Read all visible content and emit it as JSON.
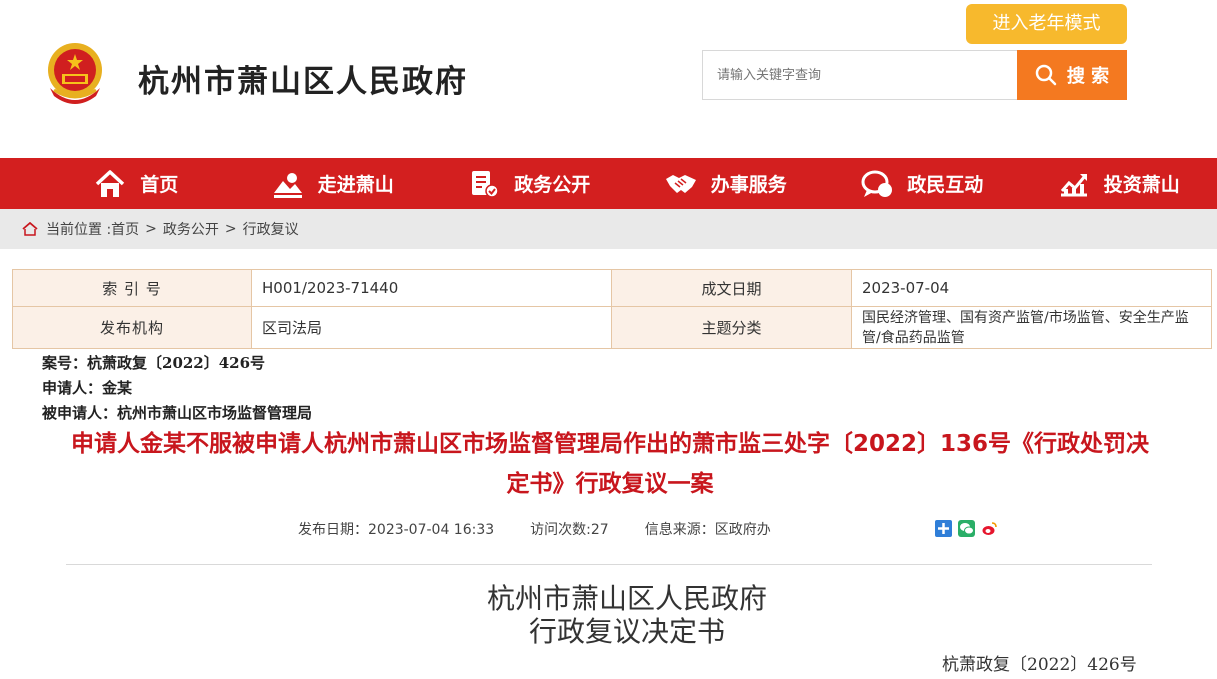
{
  "header": {
    "site_title": "杭州市萧山区人民政府",
    "elder_mode_label": "进入老年模式",
    "search_placeholder": "请输入关键字查询",
    "search_label": "搜 索"
  },
  "nav": {
    "items": [
      {
        "label": "首页",
        "icon": "home-icon"
      },
      {
        "label": "走进萧山",
        "icon": "landscape-icon"
      },
      {
        "label": "政务公开",
        "icon": "document-check-icon"
      },
      {
        "label": "办事服务",
        "icon": "handshake-icon"
      },
      {
        "label": "政民互动",
        "icon": "chat-icon"
      },
      {
        "label": "投资萧山",
        "icon": "chart-icon"
      }
    ]
  },
  "breadcrumb": {
    "prefix": "当前位置 :",
    "items": [
      "首页",
      "政务公开",
      "行政复议"
    ],
    "separator": ">"
  },
  "meta": {
    "index_label": "索 引 号",
    "index_value": "H001/2023-71440",
    "date_label": "成文日期",
    "date_value": "2023-07-04",
    "org_label": "发布机构",
    "org_value": "区司法局",
    "topic_label": "主题分类",
    "topic_value": "国民经济管理、国有资产监管/市场监管、安全生产监管/食品药品监管"
  },
  "case": {
    "case_no": "案号：杭萧政复〔2022〕426号",
    "applicant": "申请人：金某",
    "respondent": "被申请人：杭州市萧山区市场监督管理局"
  },
  "article": {
    "title": "申请人金某不服被申请人杭州市萧山区市场监督管理局作出的萧市监三处字〔2022〕136号《行政处罚决定书》行政复议一案",
    "publish_date": "发布日期：2023-07-04 16:33",
    "visits": "访问次数:27",
    "source": "信息来源：区政府办"
  },
  "document": {
    "issuer": "杭州市萧山区人民政府",
    "doc_title": "行政复议决定书",
    "doc_number": "杭萧政复〔2022〕426号"
  },
  "colors": {
    "nav_red": "#d31f1f",
    "title_red": "#c8161d",
    "search_orange": "#f47920",
    "elder_yellow": "#f7b92d"
  }
}
